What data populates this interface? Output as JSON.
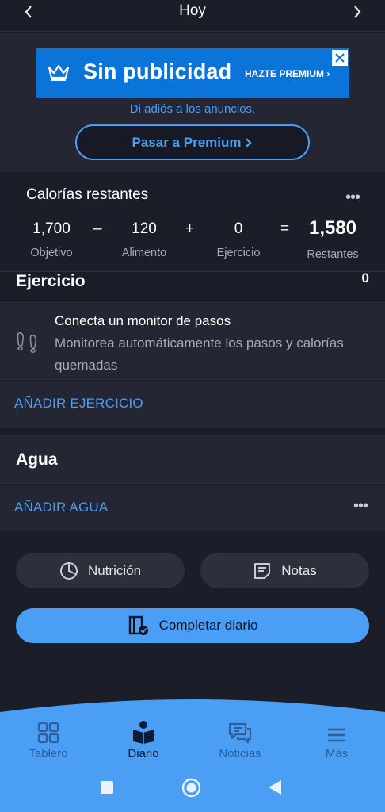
{
  "header": {
    "title": "Hoy"
  },
  "promo": {
    "banner_title": "Sin publicidad",
    "banner_cta": "HAZTE PREMIUM",
    "subtitle": "Di adiós a los anuncios.",
    "premium_button": "Pasar a Premium"
  },
  "calories": {
    "title": "Calorías restantes",
    "goal_value": "1,700",
    "goal_label": "Objetivo",
    "food_value": "120",
    "food_label": "Alimento",
    "exercise_value": "0",
    "exercise_label": "Ejercicio",
    "remaining_value": "1,580",
    "remaining_label": "Restantes",
    "op_minus": "–",
    "op_plus": "+",
    "op_equals": "="
  },
  "exercise": {
    "title": "Ejercicio",
    "value": "0",
    "steps_title": "Conecta un monitor de pasos",
    "steps_desc": "Monitorea automáticamente los pasos y calorías quemadas",
    "add_label": "AÑADIR EJERCICIO"
  },
  "water": {
    "title": "Agua",
    "add_label": "AÑADIR AGUA"
  },
  "actions": {
    "nutrition": "Nutrición",
    "notes": "Notas",
    "complete": "Completar diario"
  },
  "bottom_nav": {
    "items": [
      {
        "label": "Tablero",
        "icon": "dashboard-icon"
      },
      {
        "label": "Diario",
        "icon": "diary-icon",
        "active": true
      },
      {
        "label": "Noticias",
        "icon": "news-icon"
      },
      {
        "label": "Más",
        "icon": "menu-icon"
      }
    ]
  },
  "colors": {
    "background": "#1b1e28",
    "card": "#242733",
    "accent": "#4a9ff5",
    "banner": "#0a74d9",
    "nav": "#4a9ff5"
  }
}
